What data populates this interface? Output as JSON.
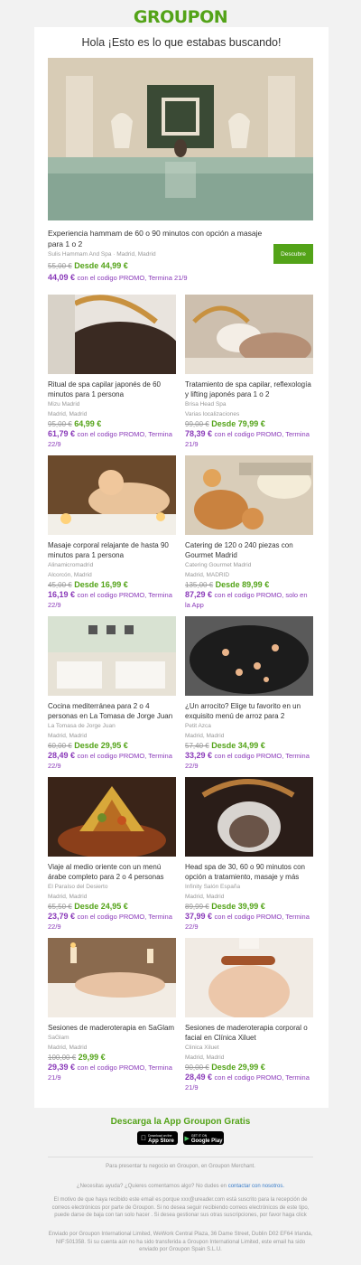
{
  "brand": "GROUPON",
  "headline": "Hola ¡Esto es lo que estabas buscando!",
  "hero": {
    "title": "Experiencia hammam de 60 o 90 minutos con opción a masaje para 1 o 2",
    "merchant": "Sulis Hammam And Spa",
    "location": "Madrid, Madrid",
    "old_price": "55,00 €",
    "new_price": "Desde 44,99 €",
    "promo_price": "44,09 €",
    "promo_text": "con el codigo PROMO, Termina 21/9",
    "button": "Descubre"
  },
  "deals": [
    {
      "title": "Ritual de spa capilar japonés de 60 minutos para 1 persona",
      "meta1": "Mizu Madrid",
      "meta2": "Madrid, Madrid",
      "old_price": "95,00 €",
      "new_price": "64,99 €",
      "promo_price": "61,79 €",
      "promo_text": "con el codigo PROMO, Termina 22/9"
    },
    {
      "title": "Tratamiento de spa capilar, reflexología y lifting japonés para 1 o 2",
      "meta1": "Brisa Head Spa",
      "meta2": "Varias localizaciones",
      "old_price": "99,00 €",
      "new_price": "Desde 79,99 €",
      "promo_price": "78,39 €",
      "promo_text": "con el codigo PROMO, Termina 21/9"
    },
    {
      "title": "Masaje corporal relajante de hasta 90 minutos para 1 persona",
      "meta1": "Alinamicromadrid",
      "meta2": "Alcorcón, Madrid",
      "old_price": "45,00 €",
      "new_price": "Desde 16,99 €",
      "promo_price": "16,19 €",
      "promo_text": "con el codigo PROMO, Termina 22/9"
    },
    {
      "title": "Catering de 120 o 240 piezas con Gourmet Madrid",
      "meta1": "Catering Gourmet Madrid",
      "meta2": "Madrid, MADRID",
      "old_price": "135,00 €",
      "new_price": "Desde 89,99 €",
      "promo_price": "87,29 €",
      "promo_text": "con el codigo PROMO, solo en la App"
    },
    {
      "title": "Cocina mediterránea para 2 o 4 personas en La Tomasa de Jorge Juan",
      "meta1": "La Tomasa de Jorge Juan",
      "meta2": "Madrid, Madrid",
      "old_price": "60,00 €",
      "new_price": "Desde 29,95 €",
      "promo_price": "28,49 €",
      "promo_text": "con el codigo PROMO, Termina 22/9"
    },
    {
      "title": "¿Un arrocito? Elige tu favorito en un exquisito menú de arroz para 2",
      "meta1": "Petit Azca",
      "meta2": "Madrid, Madrid",
      "old_price": "57,40 €",
      "new_price": "Desde 34,99 €",
      "promo_price": "33,29 €",
      "promo_text": "con el codigo PROMO, Termina 22/9"
    },
    {
      "title": "Viaje al medio oriente con un menú árabe completo para 2 o 4 personas",
      "meta1": "El Paraíso del Desierto",
      "meta2": "Madrid, Madrid",
      "old_price": "65,50 €",
      "new_price": "Desde 24,95 €",
      "promo_price": "23,79 €",
      "promo_text": "con el codigo PROMO, Termina 22/9"
    },
    {
      "title": "Head spa de 30, 60 o 90 minutos con opción a tratamiento, masaje y más",
      "meta1": "Infinity Salón España",
      "meta2": "Madrid, Madrid",
      "old_price": "89,99 €",
      "new_price": "Desde 39,99 €",
      "promo_price": "37,99 €",
      "promo_text": "con el codigo PROMO, Termina 22/9"
    },
    {
      "title": "Sesiones de maderoterapia en SaGlam",
      "meta1": "SaGlam",
      "meta2": "Madrid, Madrid",
      "old_price": "100,00 €",
      "new_price": "29,99 €",
      "promo_price": "29,39 €",
      "promo_text": "con el codigo PROMO, Termina 21/9"
    },
    {
      "title": "Sesiones de maderoterapia corporal o facial en Clínica Xiluet",
      "meta1": "Clinica Xiluet",
      "meta2": "Madrid, Madrid",
      "old_price": "90,00 €",
      "new_price": "Desde 29,99 €",
      "promo_price": "28,49 €",
      "promo_text": "con el codigo PROMO, Termina 21/9"
    }
  ],
  "app": {
    "title": "Descarga la App Groupon Gratis",
    "appstore_small": "Download on the",
    "appstore": "App Store",
    "googleplay_small": "GET IT ON",
    "googleplay": "Google Play"
  },
  "footer": {
    "merchant": "Para presentar tu negocio en Groupon, en Groupon Merchant.",
    "help": "¿Necesitas ayuda? ¿Quieres comentarnos algo? No dudes en",
    "help_link": "contactar con nosotros.",
    "reason": "El motivo de que haya recibido este email es porque xxx@ureader.com está suscrito para la recepción de correos electrónicos por parte de Groupon. Si no desea seguir recibiendo correos electrónicos de este tipo, puede darse de baja con tan solo hacer . Si desea gestionar sus otras suscripciones, por favor haga click",
    "sender": "Enviado por Groupon International Limited, WeWork Central Plaza, 36 Dame Street, Dublin D02 EF64 Irlanda, NIF:501358. Si su cuenta aún no ha sido transferida a Groupon International Limited, este email ha sido enviado por Groupon Spain S.L.U."
  }
}
